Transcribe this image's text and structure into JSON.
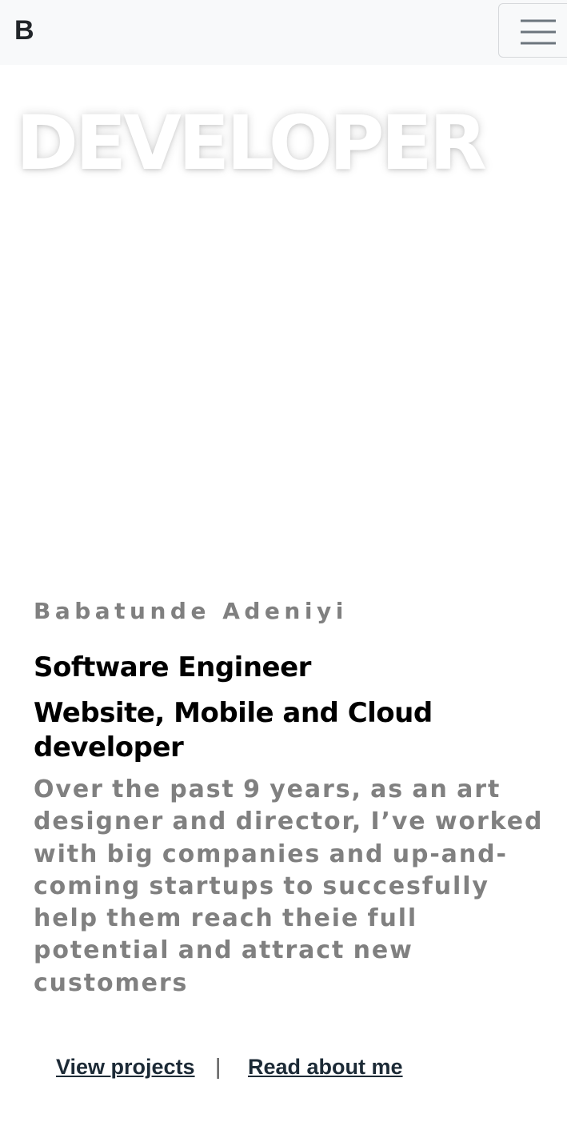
{
  "navbar": {
    "brand": "B",
    "toggler_icon": "hamburger-menu-icon"
  },
  "hero": {
    "background_word": "DEVELOPER",
    "name": "Babatunde Adeniyi",
    "role": "Software Engineer",
    "subrole": "Website, Mobile and Cloud developer",
    "description": "Over the past 9 years, as an art designer and director, I’ve worked with big companies and up-and-coming startups to succesfully help them reach theie full potential and attract new customers"
  },
  "actions": {
    "view_projects": "View projects",
    "separator": "|",
    "read_about": "Read about me"
  },
  "colors": {
    "navbar_bg": "#f8f9fa",
    "muted_text": "#808080",
    "heading_text": "#000000",
    "link_text": "#1c2a36",
    "link_highlight": "#7ec4de"
  }
}
